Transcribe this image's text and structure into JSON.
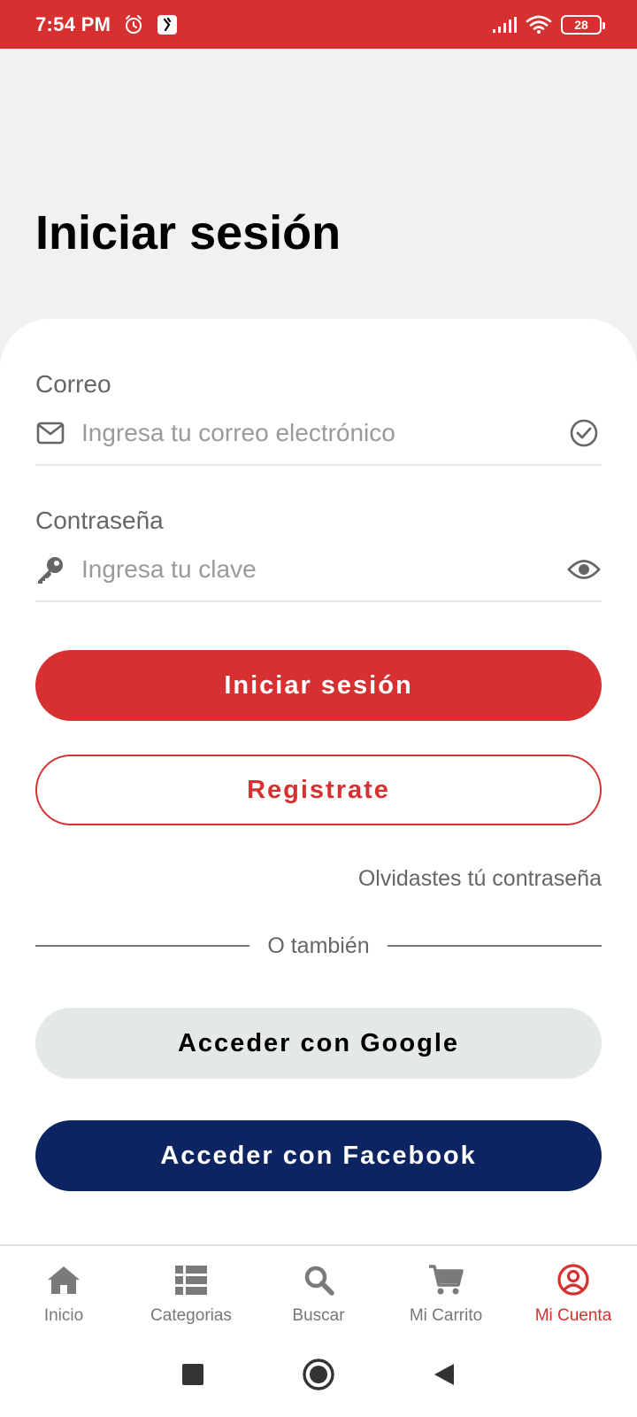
{
  "status_bar": {
    "time": "7:54 PM",
    "battery": "28",
    "icons": [
      "alarm-icon",
      "app-notification-icon",
      "signal-icon",
      "wifi-icon",
      "battery-icon"
    ]
  },
  "page": {
    "title": "Iniciar sesión"
  },
  "form": {
    "email": {
      "label": "Correo",
      "placeholder": "Ingresa tu correo electrónico",
      "value": "",
      "lead_icon": "envelope-icon",
      "trail_icon": "check-circle-icon"
    },
    "password": {
      "label": "Contraseña",
      "placeholder": "Ingresa tu clave",
      "value": "",
      "lead_icon": "key-icon",
      "trail_icon": "eye-icon"
    },
    "login_label": "Iniciar sesión",
    "register_label": "Registrate",
    "forgot_label": "Olvidastes tú contraseña",
    "divider_label": "O también",
    "google_label": "Acceder con Google",
    "facebook_label": "Acceder con Facebook"
  },
  "bottom_nav": {
    "items": [
      {
        "label": "Inicio",
        "icon": "home-icon",
        "active": false
      },
      {
        "label": "Categorias",
        "icon": "list-icon",
        "active": false
      },
      {
        "label": "Buscar",
        "icon": "search-icon",
        "active": false
      },
      {
        "label": "Mi Carrito",
        "icon": "cart-icon",
        "active": false
      },
      {
        "label": "Mi Cuenta",
        "icon": "account-icon",
        "active": true
      }
    ]
  },
  "colors": {
    "brand_red": "#d63031",
    "facebook_navy": "#0c2461",
    "google_gray": "#e4e9e8",
    "background": "#f1f1f1"
  }
}
